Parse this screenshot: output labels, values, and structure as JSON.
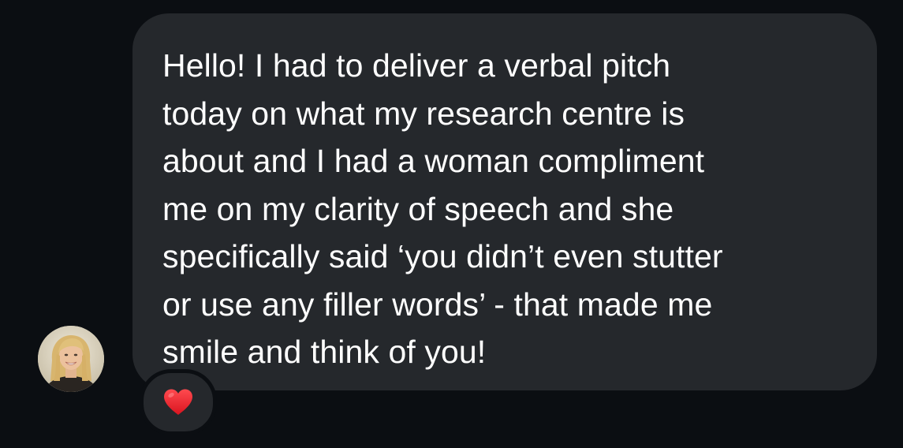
{
  "message": {
    "text": "Hello! I had to deliver a verbal pitch\ntoday on what my research centre is\nabout and I had a woman compliment\nme on my clarity of speech and she\nspecifically said ‘you didn’t even stutter\nor use any filler words’ - that made me\nsmile and think of you!",
    "reaction": {
      "icon": "red-heart-icon",
      "color": "#e8202a"
    }
  },
  "sender": {
    "avatar_icon": "profile-photo"
  },
  "colors": {
    "background": "#0b0e12",
    "bubble": "#25282c",
    "text": "#ffffff"
  }
}
